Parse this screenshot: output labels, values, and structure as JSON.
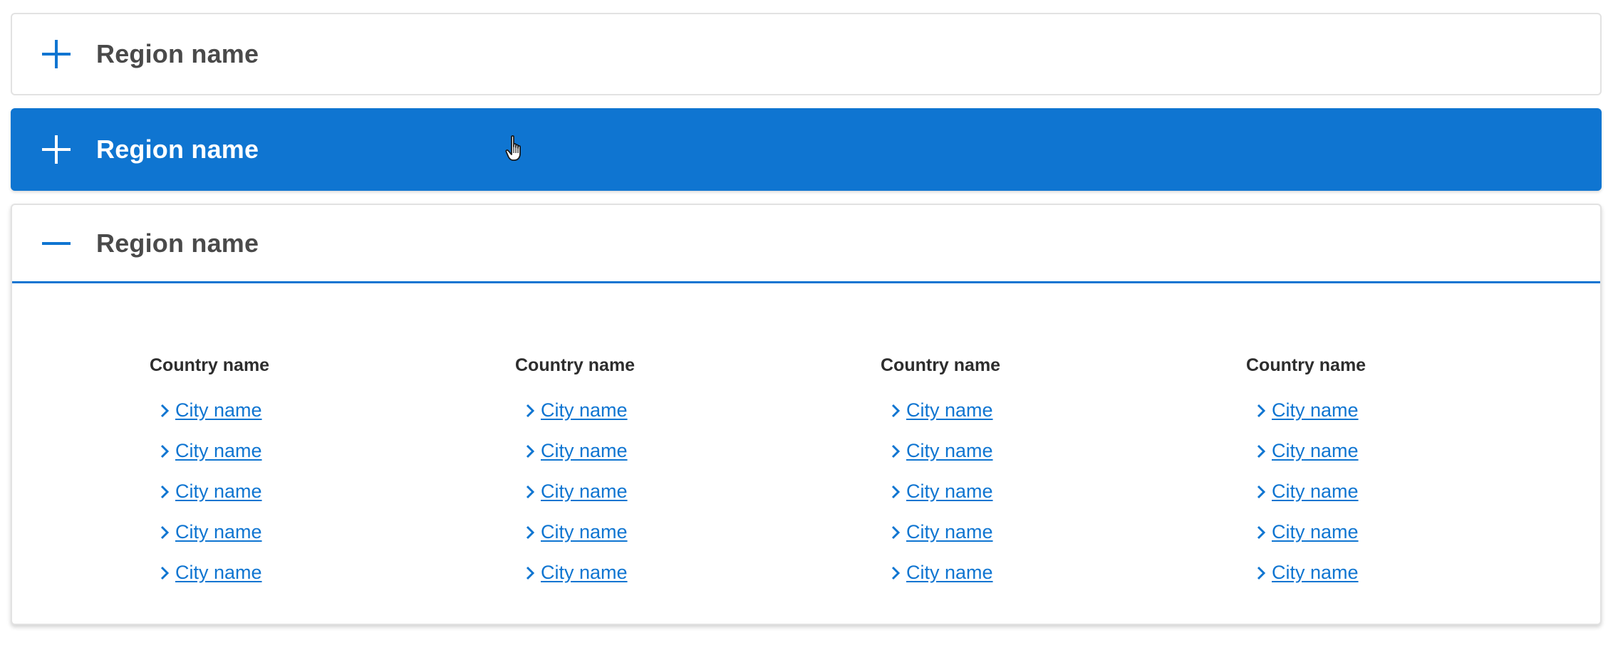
{
  "colors": {
    "accent": "#0f75d1",
    "title_text": "#4a4a4a",
    "border": "#e2e2e2",
    "hover_text": "#ffffff"
  },
  "accordions": [
    {
      "title": "Region name",
      "state": "collapsed",
      "icon": "plus-icon"
    },
    {
      "title": "Region name",
      "state": "collapsed-hover",
      "icon": "plus-icon"
    },
    {
      "title": "Region name",
      "state": "expanded",
      "icon": "minus-icon"
    }
  ],
  "expanded_panel": {
    "countries": [
      {
        "name": "Country name",
        "cities": [
          "City name",
          "City name",
          "City name",
          "City name",
          "City name"
        ]
      },
      {
        "name": "Country name",
        "cities": [
          "City name",
          "City name",
          "City name",
          "City name",
          "City name"
        ]
      },
      {
        "name": "Country name",
        "cities": [
          "City name",
          "City name",
          "City name",
          "City name",
          "City name"
        ]
      },
      {
        "name": "Country name",
        "cities": [
          "City name",
          "City name",
          "City name",
          "City name",
          "City name"
        ]
      }
    ],
    "link_icon": "chevron-right-icon"
  }
}
